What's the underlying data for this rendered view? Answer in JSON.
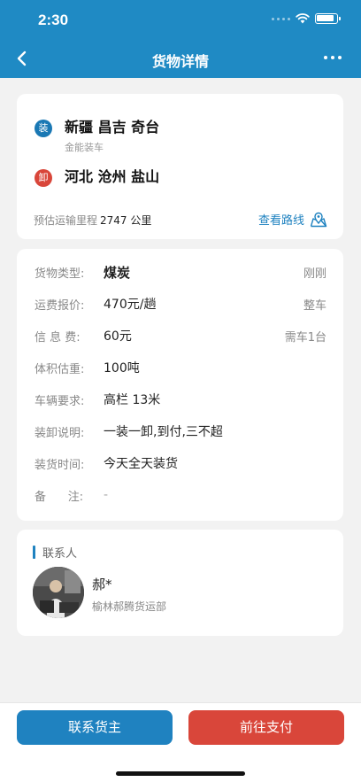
{
  "status": {
    "time": "2:30"
  },
  "nav": {
    "title": "货物详情"
  },
  "route": {
    "load": {
      "badge": "装",
      "city": "新疆 昌吉 奇台",
      "sub": "金能装车"
    },
    "unload": {
      "badge": "卸",
      "city": "河北 沧州 盐山"
    },
    "mileage_label": "预估运输里程",
    "mileage_value": "2747 公里",
    "view_route_label": "查看路线"
  },
  "cargo": {
    "rows": [
      {
        "label": "货物类型:",
        "value": "煤炭",
        "right": "刚刚"
      },
      {
        "label": "运费报价:",
        "value": "470元/趟",
        "right": "整车"
      },
      {
        "label": "信 息 费:",
        "value": "60元",
        "right": "需车1台"
      },
      {
        "label": "体积估重:",
        "value": "100吨"
      },
      {
        "label": "车辆要求:",
        "value": "高栏 13米"
      },
      {
        "label": "装卸说明:",
        "value": "一装一卸,到付,三不超"
      },
      {
        "label": "装货时间:",
        "value": "今天全天装货"
      },
      {
        "label": "备      注:",
        "value": "-"
      }
    ]
  },
  "contact": {
    "title": "联系人",
    "name": "郝*",
    "company": "榆林郝腾货运部"
  },
  "actions": {
    "contact_owner": "联系货主",
    "pay": "前往支付"
  },
  "colors": {
    "primary": "#1f8ac4",
    "danger": "#d9463a"
  }
}
